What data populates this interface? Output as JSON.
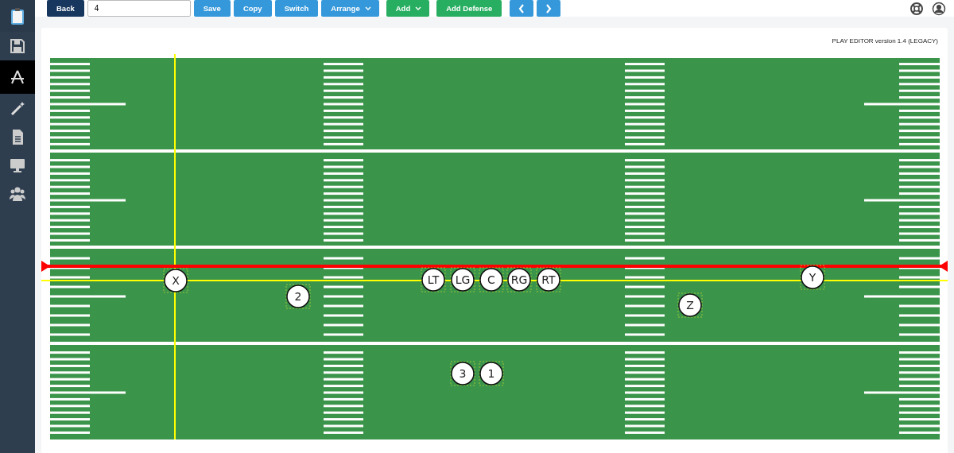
{
  "sidebar": {
    "items": [
      {
        "selected": false
      },
      {
        "selected": false
      },
      {
        "selected": true
      },
      {
        "selected": false
      },
      {
        "selected": false
      },
      {
        "selected": false
      },
      {
        "selected": false
      }
    ]
  },
  "toolbar": {
    "back": {
      "label": "Back",
      "kind": "dark"
    },
    "play_name": {
      "value": "4"
    },
    "buttons": [
      {
        "label": "Save",
        "kind": "primary",
        "dropdown": false
      },
      {
        "label": "Copy",
        "kind": "primary",
        "dropdown": false
      },
      {
        "label": "Switch",
        "kind": "primary",
        "dropdown": false
      },
      {
        "label": "Arrange",
        "kind": "primary",
        "dropdown": true
      },
      {
        "label": "Add",
        "kind": "success",
        "dropdown": true
      },
      {
        "label": "Add Defense",
        "kind": "success",
        "dropdown": false
      }
    ],
    "nav_buttons": [
      {
        "kind": "prev"
      },
      {
        "kind": "next"
      }
    ]
  },
  "editor": {
    "version": "PLAY EDITOR version 1.4 (LEGACY)",
    "players": [
      {
        "label": "X"
      },
      {
        "label": "LT"
      },
      {
        "label": "LG"
      },
      {
        "label": "C"
      },
      {
        "label": "RG"
      },
      {
        "label": "RT"
      },
      {
        "label": "Y"
      },
      {
        "label": "2"
      },
      {
        "label": "Z"
      },
      {
        "label": "3"
      },
      {
        "label": "1"
      }
    ]
  }
}
